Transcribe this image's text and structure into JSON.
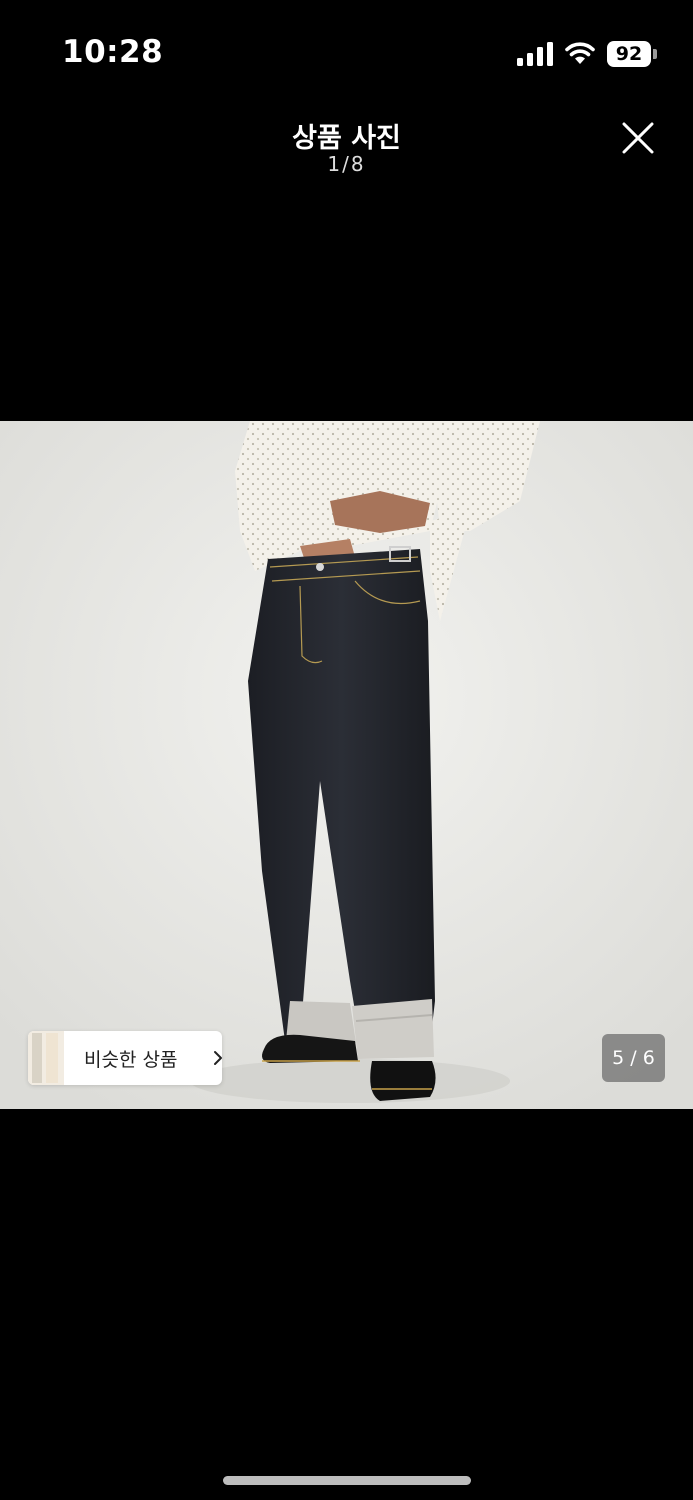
{
  "status_bar": {
    "time": "10:28",
    "battery": "92",
    "signal_icon": "cellular-signal-icon",
    "wifi_icon": "wifi-icon"
  },
  "header": {
    "title": "상품 사진",
    "counter": "1/8",
    "close_icon": "close-icon"
  },
  "photo": {
    "similar_button_label": "비슷한 상품",
    "slide_counter": "5 / 6"
  },
  "colors": {
    "background": "#000000",
    "photo_background": "#e9e8e4",
    "denim": "#23252b",
    "shirt": "#f3f0e8"
  }
}
